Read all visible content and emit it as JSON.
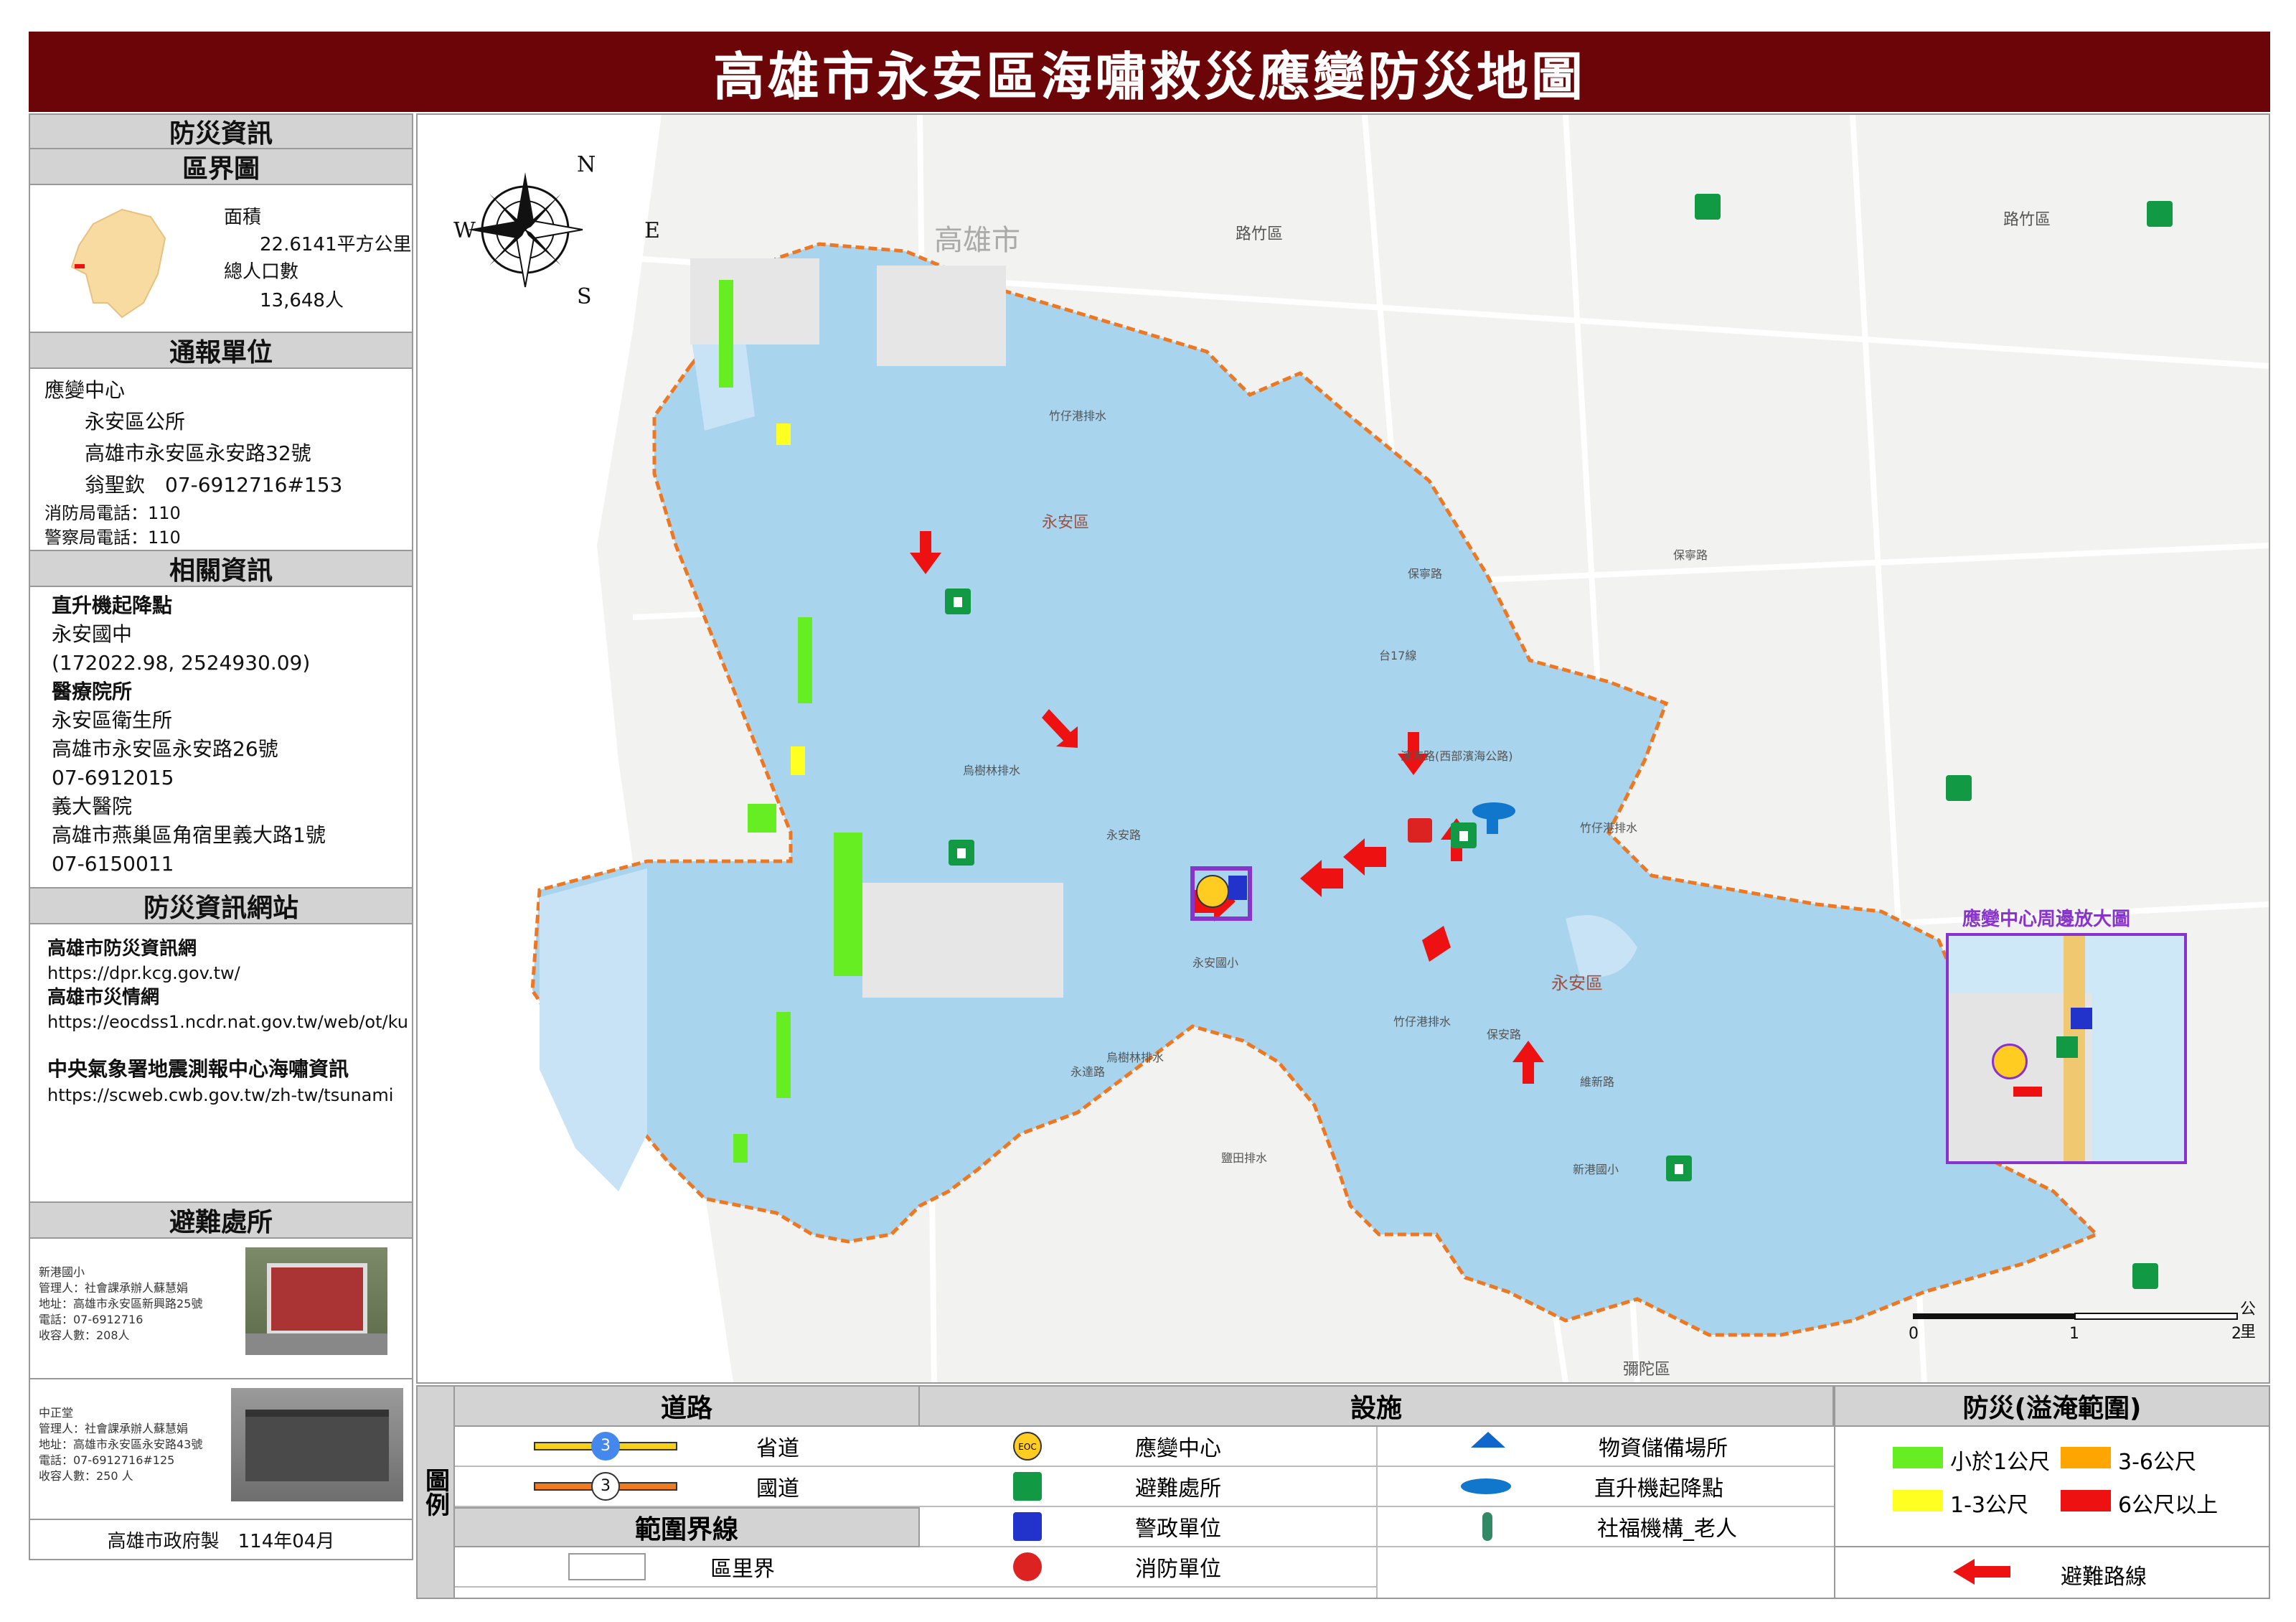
{
  "title": "高雄市永安區海嘯救災應變防災地圖",
  "sidebar": {
    "info_header": "防災資訊",
    "district_header": "區界圖",
    "area_label": "面積",
    "area_value": "22.6141平方公里",
    "pop_label": "總人口數",
    "pop_value": "13,648人",
    "report_header": "通報單位",
    "report": {
      "center_label": "應變中心",
      "office": "永安區公所",
      "address": "高雄市永安區永安路32號",
      "contact": "翁聖欽　07-6912716#153",
      "fire_phone": "消防局電話：110",
      "police_phone": "警察局電話：110"
    },
    "related_header": "相關資訊",
    "related": {
      "heli_title": "直升機起降點",
      "heli_name": "永安國中",
      "heli_coord": "(172022.98, 2524930.09)",
      "medical_title": "醫療院所",
      "clinic_name": "永安區衛生所",
      "clinic_addr": "高雄市永安區永安路26號",
      "clinic_phone": "07-6912015",
      "hospital_name": "義大醫院",
      "hospital_addr": "高雄市燕巢區角宿里義大路1號",
      "hospital_phone": "07-6150011"
    },
    "web_header": "防災資訊網站",
    "websites": [
      {
        "name": "高雄市防災資訊網",
        "url": "https://dpr.kcg.gov.tw/"
      },
      {
        "name": "高雄市災情網",
        "url": "https://eocdss1.ncdr.nat.gov.tw/web/ot/ku"
      },
      {
        "name": "中央氣象署地震測報中心海嘯資訊",
        "url": "https://scweb.cwb.gov.tw/zh-tw/tsunami"
      }
    ],
    "shelter_header": "避難處所",
    "shelters": [
      {
        "name": "新港國小",
        "manager": "管理人：社會課承辦人蘇慧娟",
        "address": "地址：高雄市永安區新興路25號",
        "phone": "電話：07-6912716",
        "capacity": "收容人數：208人"
      },
      {
        "name": "中正堂",
        "manager": "管理人：社會課承辦人蘇慧娟",
        "address": "地址：高雄市永安區永安路43號",
        "phone": "電話：07-6912716#125",
        "capacity": "收容人數：250 人"
      }
    ],
    "footer": "高雄市政府製　114年04月"
  },
  "map": {
    "compass": {
      "n": "N",
      "s": "S",
      "e": "E",
      "w": "W"
    },
    "city_label": "高雄市",
    "district_label": "永安區",
    "district_label2": "永安區",
    "place_labels": [
      "路竹區",
      "路竹區",
      "彌陀區",
      "竹仔港排水",
      "保寧路",
      "保安路",
      "永安國小",
      "新港國小",
      "維新路",
      "竹仔港排水",
      "永安路",
      "永達路",
      "烏樹林排水",
      "烏樹林排水",
      "鹽田排水",
      "濱海路(西部濱海公路)",
      "台17線",
      "竹仔港排水",
      "保寧路"
    ],
    "inset_title": "應變中心周邊放大圖",
    "scale_unit": "公里",
    "scale_ticks": [
      "0",
      "1",
      "2"
    ]
  },
  "legend": {
    "side_label": "圖例",
    "roads_header": "道路",
    "roads": [
      {
        "shield": "3",
        "label": "省道",
        "color": "#f7d117"
      },
      {
        "shield": "3",
        "label": "國道",
        "color": "#f07b1e"
      }
    ],
    "boundary_header": "範圍界線",
    "boundary_label": "區里界",
    "facilities_header": "設施",
    "facilities": [
      {
        "icon": "eoc-icon",
        "text": "EOC",
        "label": "應變中心"
      },
      {
        "icon": "shelter-icon",
        "label": "避難處所"
      },
      {
        "icon": "police-icon",
        "label": "警政單位"
      },
      {
        "icon": "fire-icon",
        "label": "消防單位"
      },
      {
        "icon": "warehouse-icon",
        "label": "物資儲備場所"
      },
      {
        "icon": "helicopter-icon",
        "label": "直升機起降點"
      },
      {
        "icon": "elderly-icon",
        "label": "社福機構_老人"
      }
    ],
    "hazard_header": "防災(溢淹範圍)",
    "hazard": [
      {
        "label": "小於1公尺",
        "color": "#66ee22"
      },
      {
        "label": "3-6公尺",
        "color": "#ffa500"
      },
      {
        "label": "1-3公尺",
        "color": "#ffff22"
      },
      {
        "label": "6公尺以上",
        "color": "#ee1111"
      }
    ],
    "route_label": "避難路線"
  }
}
